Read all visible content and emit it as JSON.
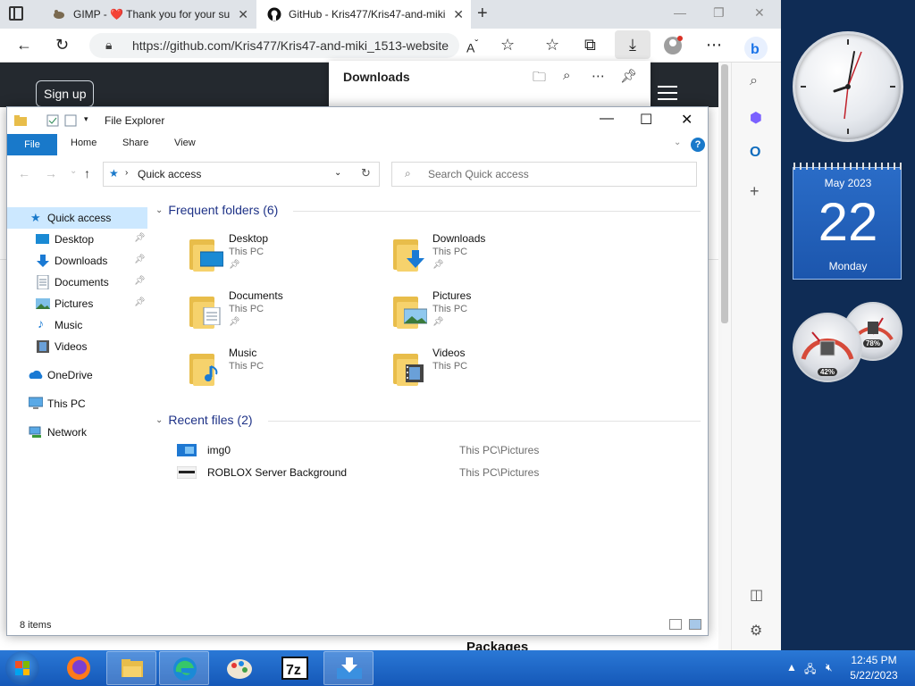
{
  "browser": {
    "tabs": [
      {
        "title": "GIMP - ❤️ Thank you for your su"
      },
      {
        "title": "GitHub - Kris477/Kris47-and-miki"
      }
    ],
    "url": "https://github.com/Kris477/Kris47-and-miki_1513-website",
    "page": {
      "signup_label": "Sign up",
      "packages_heading": "Packages"
    },
    "downloads_title": "Downloads"
  },
  "explorer": {
    "title": "File Explorer",
    "ribbon_tabs": [
      "File",
      "Home",
      "Share",
      "View"
    ],
    "address": "Quick access",
    "search_placeholder": "Search Quick access",
    "nav": {
      "quick_access": "Quick access",
      "pinned": [
        "Desktop",
        "Downloads",
        "Documents",
        "Pictures"
      ],
      "other": [
        "Music",
        "Videos"
      ],
      "onedrive": "OneDrive",
      "this_pc": "This PC",
      "network": "Network"
    },
    "frequent_header": "Frequent folders (6)",
    "frequent": [
      {
        "name": "Desktop",
        "location": "This PC",
        "pinned": true,
        "icon": "desktop-icon"
      },
      {
        "name": "Downloads",
        "location": "This PC",
        "pinned": true,
        "icon": "downloads-icon"
      },
      {
        "name": "Documents",
        "location": "This PC",
        "pinned": true,
        "icon": "documents-icon"
      },
      {
        "name": "Pictures",
        "location": "This PC",
        "pinned": true,
        "icon": "pictures-icon"
      },
      {
        "name": "Music",
        "location": "This PC",
        "pinned": false,
        "icon": "music-icon"
      },
      {
        "name": "Videos",
        "location": "This PC",
        "pinned": false,
        "icon": "videos-icon"
      }
    ],
    "recent_header": "Recent files (2)",
    "recent": [
      {
        "name": "img0",
        "location": "This PC\\Pictures"
      },
      {
        "name": "ROBLOX Server Background",
        "location": "This PC\\Pictures"
      }
    ],
    "status": "8 items"
  },
  "gadgets": {
    "calendar": {
      "month": "May 2023",
      "day": "22",
      "weekday": "Monday"
    },
    "cpu_meter": {
      "cpu": "42%",
      "memory": "78%"
    }
  },
  "taskbar": {
    "time": "12:45 PM",
    "date": "5/22/2023",
    "apps": [
      "firefox-icon",
      "file-explorer-icon",
      "edge-icon",
      "paint-icon",
      "7zip-icon",
      "downloads-app-icon"
    ]
  },
  "colors": {
    "accent": "#1979ca",
    "taskbar": "#1558b8",
    "selected_nav": "#cce8ff",
    "calendar": "#2a6cc7"
  }
}
